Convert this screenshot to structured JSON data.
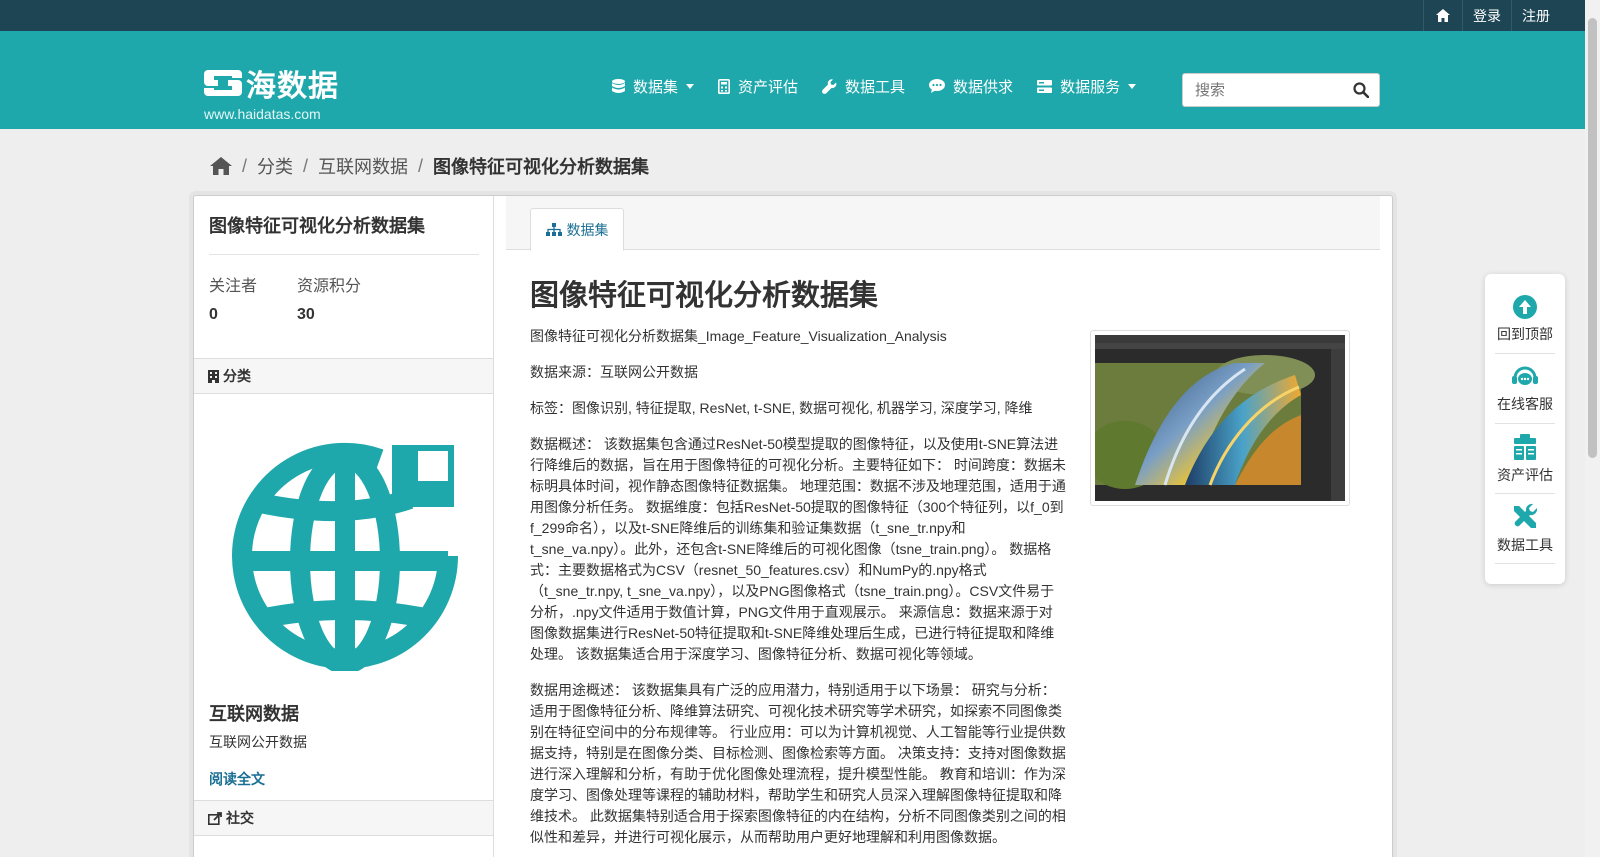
{
  "account": {
    "login": "登录",
    "register": "注册"
  },
  "brand": {
    "name": "海数据",
    "url": "www.haidatas.com"
  },
  "nav": {
    "datasets": "数据集",
    "asset_eval": "资产评估",
    "data_tools": "数据工具",
    "data_supply": "数据供求",
    "data_service": "数据服务"
  },
  "search": {
    "placeholder": "搜索"
  },
  "breadcrumb": {
    "category": "分类",
    "parent": "互联网数据",
    "current": "图像特征可视化分析数据集"
  },
  "sidebar": {
    "title": "图像特征可视化分析数据集",
    "followers_label": "关注者",
    "followers_value": "0",
    "points_label": "资源积分",
    "points_value": "30",
    "category_head": "分类",
    "category_name": "互联网数据",
    "category_desc": "互联网公开数据",
    "read_more": "阅读全文",
    "social_head": "社交"
  },
  "content": {
    "tab_label": "数据集",
    "heading": "图像特征可视化分析数据集",
    "paragraphs": [
      "图像特征可视化分析数据集_Image_Feature_Visualization_Analysis",
      "数据来源：互联网公开数据",
      "标签：图像识别, 特征提取, ResNet, t-SNE, 数据可视化, 机器学习, 深度学习, 降维",
      "数据概述： 该数据集包含通过ResNet-50模型提取的图像特征，以及使用t-SNE算法进行降维后的数据，旨在用于图像特征的可视化分析。主要特征如下： 时间跨度：数据未标明具体时间，视作静态图像特征数据集。 地理范围：数据不涉及地理范围，适用于通用图像分析任务。 数据维度：包括ResNet-50提取的图像特征（300个特征列，以f_0到f_299命名），以及t-SNE降维后的训练集和验证集数据（t_sne_tr.npy和t_sne_va.npy）。此外，还包含t-SNE降维后的可视化图像（tsne_train.png）。 数据格式：主要数据格式为CSV（resnet_50_features.csv）和NumPy的.npy格式（t_sne_tr.npy, t_sne_va.npy），以及PNG图像格式（tsne_train.png）。CSV文件易于分析，.npy文件适用于数值计算，PNG文件用于直观展示。 来源信息：数据来源于对图像数据集进行ResNet-50特征提取和t-SNE降维处理后生成，已进行特征提取和降维处理。 该数据集适合用于深度学习、图像特征分析、数据可视化等领域。",
      "数据用途概述： 该数据集具有广泛的应用潜力，特别适用于以下场景： 研究与分析：适用于图像特征分析、降维算法研究、可视化技术研究等学术研究，如探索不同图像类别在特征空间中的分布规律等。 行业应用：可以为计算机视觉、人工智能等行业提供数据支持，特别是在图像分类、目标检测、图像检索等方面。 决策支持：支持对图像数据进行深入理解和分析，有助于优化图像处理流程，提升模型性能。 教育和培训：作为深度学习、图像处理等课程的辅助材料，帮助学生和研究人员深入理解图像特征提取和降维技术。 此数据集特别适合用于探索图像特征的内在结构，分析不同图像类别之间的相似性和差异，并进行可视化展示，从而帮助用户更好地理解和利用图像数据。"
    ]
  },
  "floatbar": {
    "back_to_top": "回到顶部",
    "online_service": "在线客服",
    "asset_eval": "资产评估",
    "data_tools": "数据工具"
  },
  "colors": {
    "header_bg": "#1fa8ab",
    "topbar_bg": "#1d4553",
    "link": "#1a6f94",
    "icon_teal": "#1fa8ab"
  }
}
